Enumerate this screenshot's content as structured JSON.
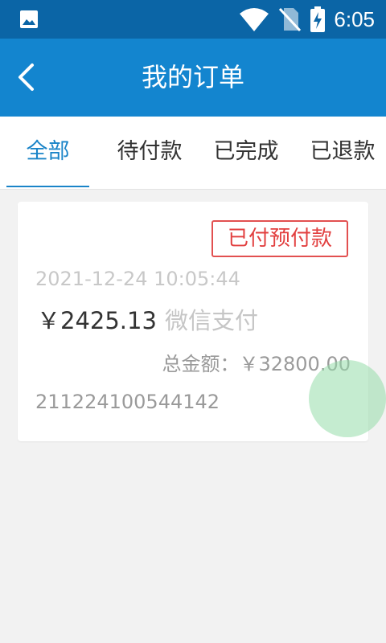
{
  "status_bar": {
    "time": "6:05",
    "icons": [
      "image-icon",
      "wifi-icon",
      "no-sim-icon",
      "battery-charging-icon"
    ]
  },
  "app_bar": {
    "title": "我的订单",
    "back_icon": "chevron-left-icon"
  },
  "tabs": [
    {
      "label": "全部",
      "active": true
    },
    {
      "label": "待付款",
      "active": false
    },
    {
      "label": "已完成",
      "active": false
    },
    {
      "label": "已退款",
      "active": false
    }
  ],
  "orders": [
    {
      "status": "已付预付款",
      "datetime": "2021-12-24 10:05:44",
      "paid_amount": "￥2425.13",
      "pay_method": "微信支付",
      "total_label": "总金额：",
      "total_amount": "￥32800.00",
      "order_no": "211224100544142"
    }
  ],
  "colors": {
    "status_bar": "#0b65a6",
    "app_bar": "#1385cf",
    "active_tab": "#1a84c8",
    "badge_red": "#e24040",
    "fab": "#96dcaa"
  }
}
